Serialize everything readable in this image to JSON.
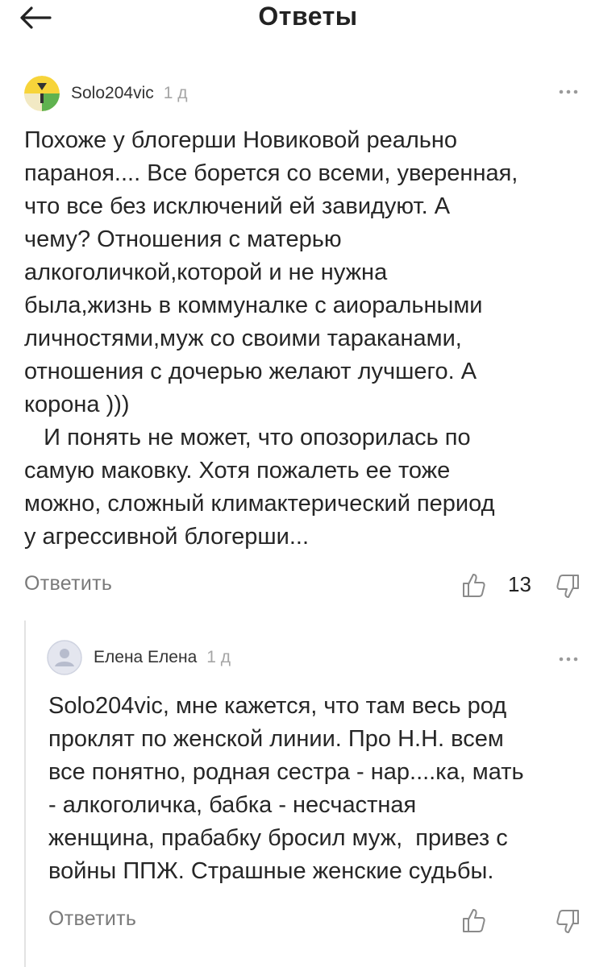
{
  "header": {
    "title": "Ответы"
  },
  "comments": [
    {
      "author": "Solo204vic",
      "time": "1 д",
      "text": "Похоже у блогерши Новиковой реально\nпараноя.... Все борется со всеми, уверенная,\nчто все без исключений ей завидуют. А\nчему? Отношения с матерью\nалкоголичкой,которой и не нужна\nбыла,жизнь в коммуналке с аиоральными\nличностями,муж со своими тараканами,\nотношения с дочерью желают лучшего. А\nкорона )))\n   И понять не может, что опозорилась по\nсамую маковку. Хотя пожалеть ее тоже\nможно, сложный климактерический период\nу агрессивной блогерши...",
      "reply_label": "Ответить",
      "likes": "13"
    },
    {
      "author": "Елена Елена",
      "time": "1 д",
      "text": "Solo204vic, мне кажется, что там весь род\nпроклят по женской линии. Про Н.Н. всем\nвсе понятно, родная сестра - нар....ка, мать\n- алкоголичка, бабка - несчастная\nженщина, прабабку бросил муж,  привез с\nвойны ППЖ. Страшные женские судьбы.",
      "reply_label": "Ответить",
      "likes": ""
    }
  ]
}
